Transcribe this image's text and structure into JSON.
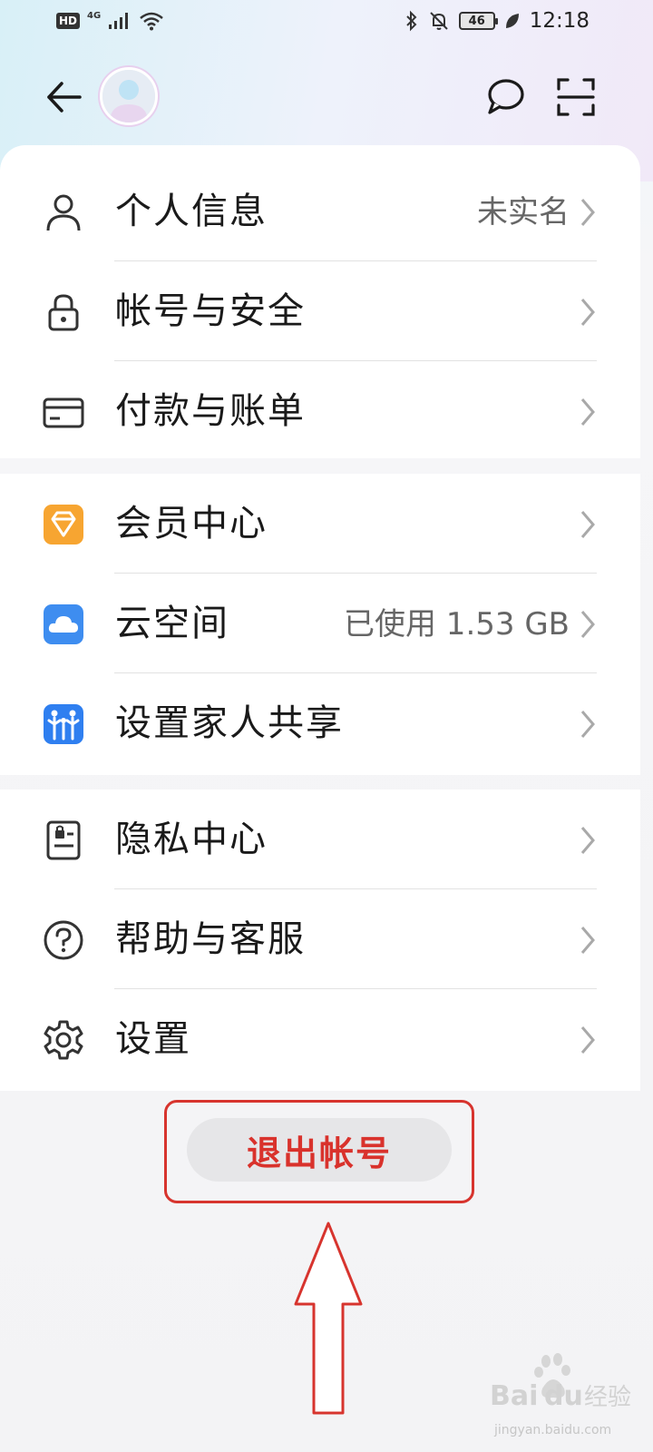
{
  "status_bar": {
    "hd": "HD",
    "network": "4G",
    "battery": "46",
    "time": "12:18"
  },
  "header": {
    "back_icon": "arrow-left-icon",
    "avatar_icon": "user-avatar",
    "message_icon": "speech-bubble-icon",
    "scan_icon": "scan-frame-icon"
  },
  "groups": [
    {
      "items": [
        {
          "label": "个人信息",
          "value": "未实名",
          "icon": "person-outline-icon"
        },
        {
          "label": "帐号与安全",
          "value": "",
          "icon": "lock-icon"
        },
        {
          "label": "付款与账单",
          "value": "",
          "icon": "card-icon"
        }
      ]
    },
    {
      "items": [
        {
          "label": "会员中心",
          "value": "",
          "icon": "diamond-icon"
        },
        {
          "label": "云空间",
          "value": "已使用 1.53 GB",
          "icon": "cloud-icon"
        },
        {
          "label": "设置家人共享",
          "value": "",
          "icon": "family-icon"
        }
      ]
    },
    {
      "items": [
        {
          "label": "隐私中心",
          "value": "",
          "icon": "privacy-icon"
        },
        {
          "label": "帮助与客服",
          "value": "",
          "icon": "help-icon"
        },
        {
          "label": "设置",
          "value": "",
          "icon": "gear-icon"
        }
      ]
    }
  ],
  "logout": {
    "label": "退出帐号"
  },
  "colors": {
    "accent_red": "#d9322c",
    "vip_orange": "#f7a531",
    "cloud_blue": "#3e8df0"
  },
  "watermark": {
    "text": "jingyan.baidu.com"
  }
}
